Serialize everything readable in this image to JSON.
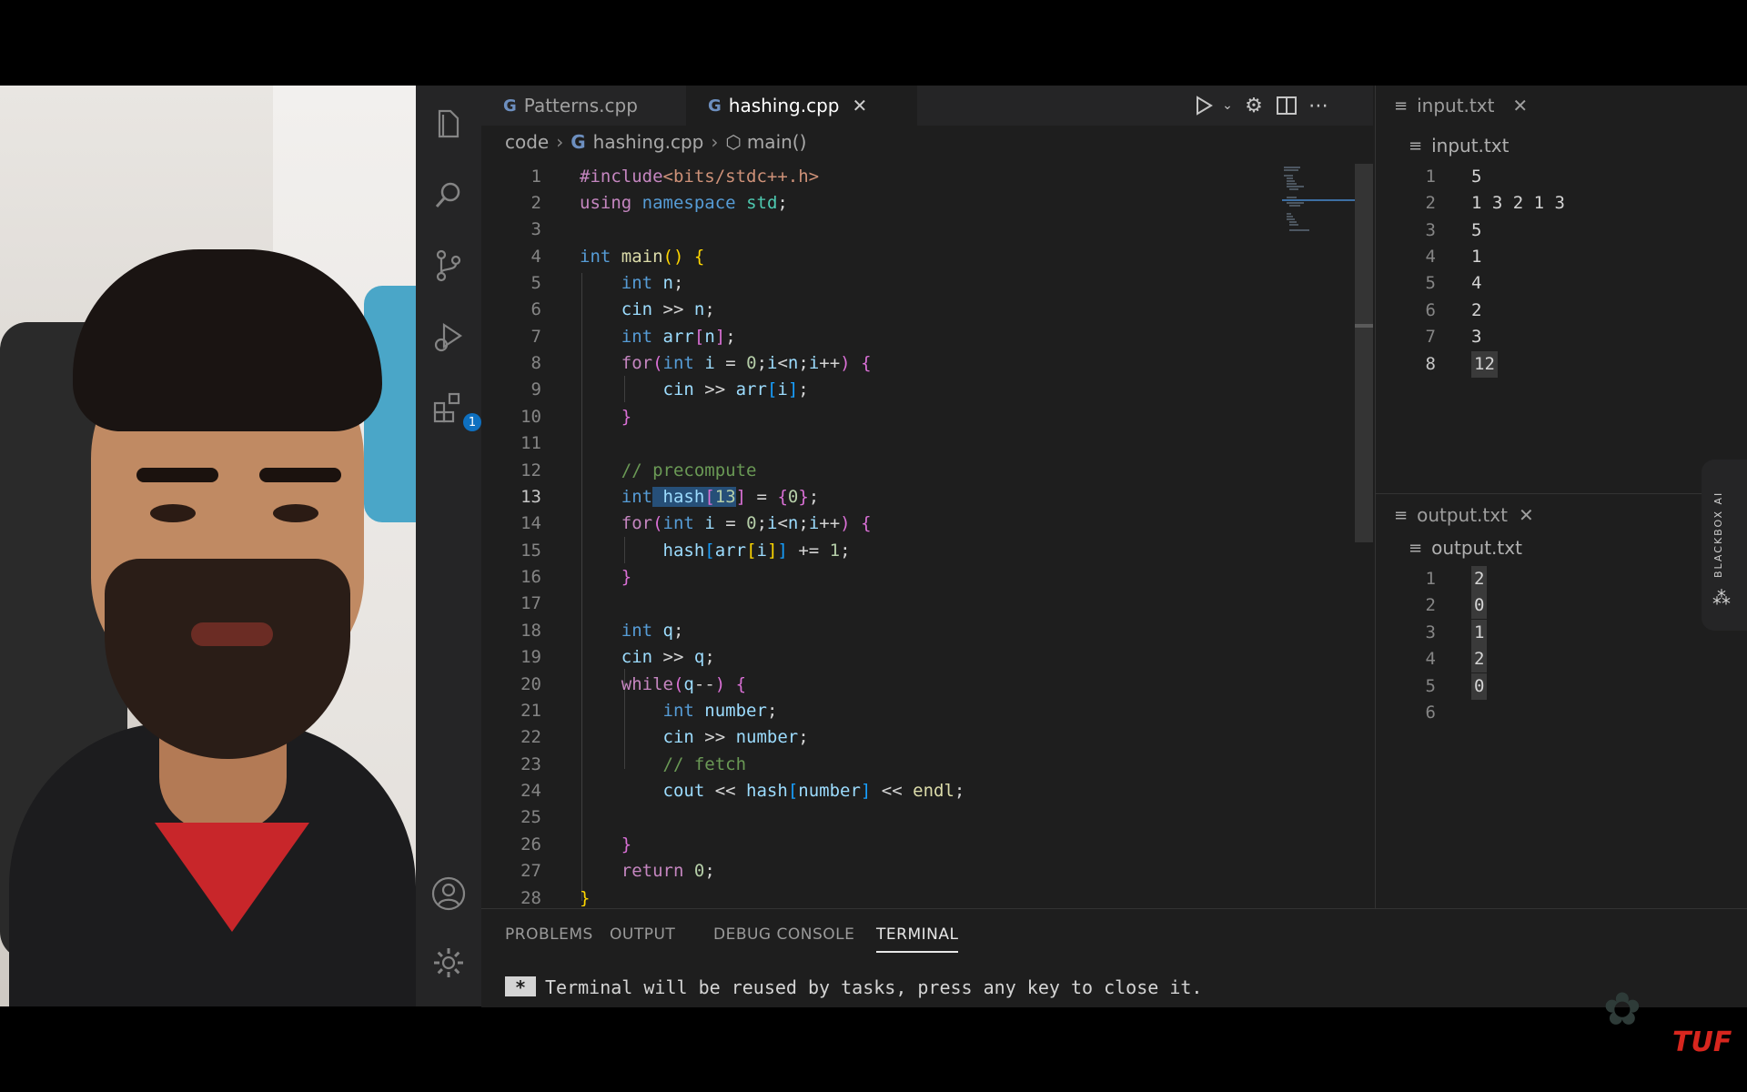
{
  "editor": {
    "tabs": [
      {
        "label": "Patterns.cpp",
        "active": false
      },
      {
        "label": "hashing.cpp",
        "active": true
      }
    ],
    "breadcrumb": [
      "code",
      "hashing.cpp",
      "main()"
    ],
    "icons": {
      "file": "cpp-file-icon",
      "run": "run-icon",
      "settings": "gear-icon",
      "split": "split-editor-icon",
      "more": "more-actions-icon"
    }
  },
  "activity_bar": {
    "extensions_badge": "1"
  },
  "code": {
    "current_line": 13,
    "line_numbers": [
      "1",
      "2",
      "3",
      "4",
      "5",
      "6",
      "7",
      "8",
      "9",
      "10",
      "11",
      "12",
      "13",
      "14",
      "15",
      "16",
      "17",
      "18",
      "19",
      "20",
      "21",
      "22",
      "23",
      "24",
      "25",
      "26",
      "27",
      "28"
    ]
  },
  "input_file": {
    "tab_label": "input.txt",
    "breadcrumb": "input.txt",
    "lines": [
      "5",
      "1 3 2 1 3",
      "5",
      "1",
      "4",
      "2",
      "3",
      "12"
    ]
  },
  "output_file": {
    "tab_label": "output.txt",
    "breadcrumb": "output.txt",
    "lines": [
      "2",
      "0",
      "1",
      "2",
      "0",
      ""
    ]
  },
  "panel": {
    "tabs": [
      "PROBLEMS",
      "OUTPUT",
      "DEBUG CONSOLE",
      "TERMINAL"
    ],
    "active_tab": "TERMINAL",
    "terminal_star": "*",
    "terminal_text": "Terminal will be reused by tasks, press any key to close it."
  },
  "blackbox": {
    "label": "BLACKBOX AI"
  },
  "branding": {
    "logo": "TUF"
  },
  "colors": {
    "keyword": "#569cd6",
    "control": "#c586c0",
    "function": "#dcdcaa",
    "variable": "#9cdcfe",
    "number": "#b5cea8",
    "string": "#ce9178",
    "comment": "#6a9955",
    "logo": "#d7261e"
  }
}
